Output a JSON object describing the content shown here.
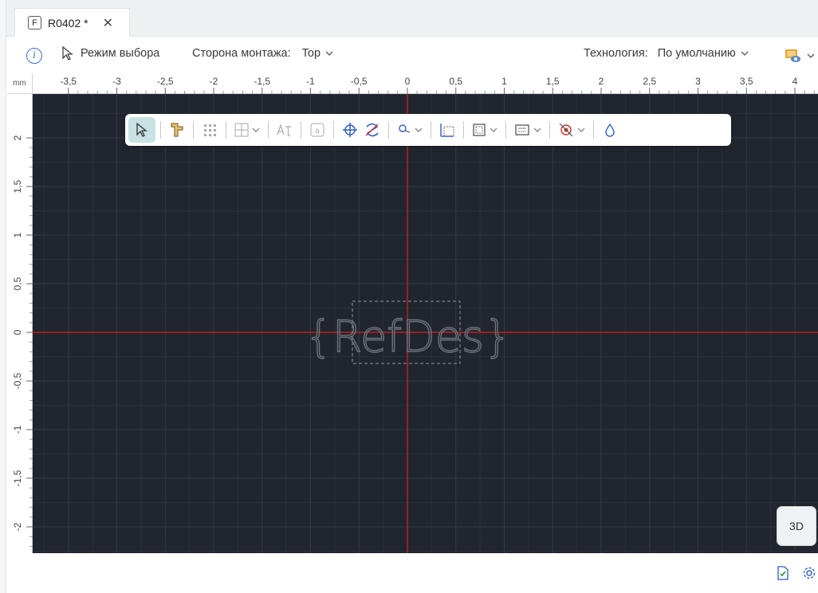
{
  "tab": {
    "badge": "F",
    "title": "R0402 *",
    "close": "✕"
  },
  "toolbar": {
    "info": "i",
    "mode_label": "Режим выбора",
    "side_label": "Сторона монтажа:",
    "side_value": "Top",
    "tech_label": "Технология:",
    "tech_value": "По умолчанию"
  },
  "ruler": {
    "unit": "mm",
    "x_ticks": [
      "-3,5",
      "-3",
      "-2,5",
      "-2",
      "-1,5",
      "-1",
      "-0,5",
      "0",
      "0,5",
      "1",
      "1,5",
      "2",
      "2,5",
      "3",
      "3,5",
      "4"
    ],
    "y_ticks": [
      "2",
      "1,5",
      "1",
      "0,5",
      "0",
      "-0,5",
      "-1",
      "-1,5",
      "-2"
    ]
  },
  "canvas": {
    "background": "#20252e",
    "axis_color": "#c0201f",
    "refdes_text": "{RefDes}"
  },
  "floating_toolbar": {
    "accent": "#c8e2e3"
  },
  "btn3d_label": "3D"
}
